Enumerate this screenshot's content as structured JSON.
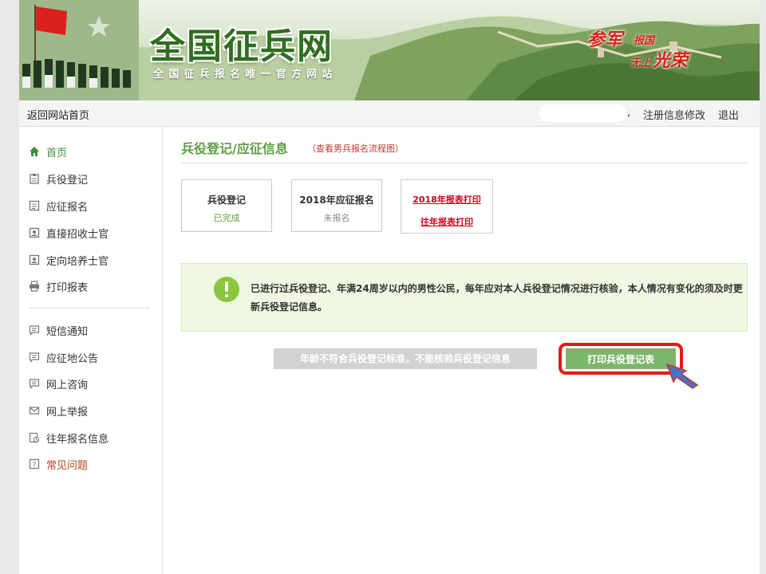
{
  "header": {
    "site_title": "全国征兵网",
    "site_subtitle": "全国征兵报名唯一官方网站",
    "slogan": {
      "part1": "参军",
      "part2": "报国",
      "part3": "无上",
      "part4": "光荣"
    }
  },
  "topnav": {
    "home_link": "返回网站首页",
    "user_name": "",
    "separator": ",",
    "edit_profile": "注册信息修改",
    "logout": "退出"
  },
  "sidebar": {
    "items_top": [
      {
        "label": "首页",
        "icon": "home-icon"
      },
      {
        "label": "兵役登记",
        "icon": "clipboard-icon"
      },
      {
        "label": "应征报名",
        "icon": "form-icon"
      },
      {
        "label": "直接招收士官",
        "icon": "id-card-icon"
      },
      {
        "label": "定向培养士官",
        "icon": "id-card-icon"
      },
      {
        "label": "打印报表",
        "icon": "printer-icon"
      }
    ],
    "items_bottom": [
      {
        "label": "短信通知",
        "icon": "message-icon"
      },
      {
        "label": "应征地公告",
        "icon": "message-icon"
      },
      {
        "label": "网上咨询",
        "icon": "message-icon"
      },
      {
        "label": "网上举报",
        "icon": "mail-icon"
      },
      {
        "label": "往年报名信息",
        "icon": "history-icon"
      },
      {
        "label": "常见问题",
        "icon": "question-icon"
      }
    ]
  },
  "main": {
    "title": "兵役登记/应征信息",
    "flow_link": "（查看男兵报名流程图）",
    "cards": [
      {
        "title": "兵役登记",
        "status": "已完成"
      },
      {
        "title": "2018年应征报名",
        "status": "未报名"
      }
    ],
    "print_card": {
      "link1": "2018年报表打印",
      "link2": "往年报表打印"
    },
    "alert_message": "已进行过兵役登记、年满24周岁以内的男性公民，每年应对本人兵役登记情况进行核验，本人情况有变化的须及时更新兵役登记信息。",
    "disabled_button": "年龄不符合兵役登记标准，不能核验兵役登记信息",
    "print_button": "打印兵役登记表"
  },
  "colors": {
    "accent_green": "#5d9e45",
    "print_button": "#7cb66a",
    "highlight_red": "#e31b14",
    "alert_bg": "#eef8e2"
  }
}
